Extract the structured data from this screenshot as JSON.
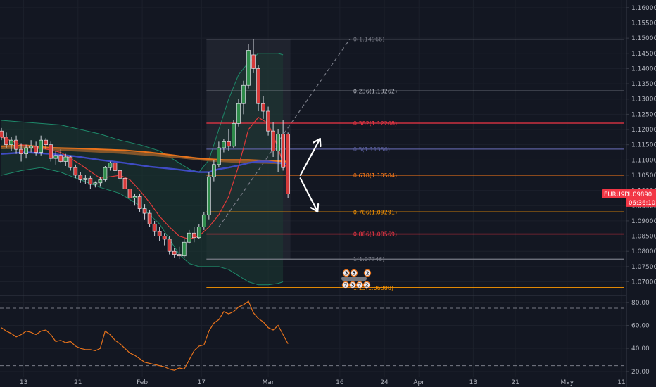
{
  "chart_data": {
    "type": "candlestick",
    "symbol": "EURUSD",
    "last_price": "1.09890",
    "countdown": "06:36:10",
    "price_axis": {
      "ylim": [
        1.0655,
        1.1625
      ],
      "ticks": [
        "1.16000",
        "1.15500",
        "1.15000",
        "1.14500",
        "1.14000",
        "1.13500",
        "1.13000",
        "1.12500",
        "1.12000",
        "1.11500",
        "1.11000",
        "1.10500",
        "1.10000",
        "1.09500",
        "1.09000",
        "1.08500",
        "1.08000",
        "1.07500",
        "1.07000"
      ]
    },
    "rsi_axis": {
      "ylim": [
        15,
        86
      ],
      "ticks": [
        "80.00",
        "60.00",
        "40.00",
        "20.00"
      ],
      "levels": [
        75,
        25
      ]
    },
    "x_axis": {
      "labels": [
        {
          "text": "13",
          "t": 4.5
        },
        {
          "text": "21",
          "t": 15.5
        },
        {
          "text": "Feb",
          "t": 28.5
        },
        {
          "text": "17",
          "t": 40.5
        },
        {
          "text": "Mar",
          "t": 54
        },
        {
          "text": "16",
          "t": 68.5
        },
        {
          "text": "24",
          "t": 77.5
        },
        {
          "text": "Apr",
          "t": 84.5
        },
        {
          "text": "13",
          "t": 95.5
        },
        {
          "text": "21",
          "t": 104
        },
        {
          "text": "May",
          "t": 114.5
        },
        {
          "text": "11",
          "t": 125.5
        }
      ]
    },
    "candles": [
      {
        "o": 1.1195,
        "h": 1.1205,
        "l": 1.1165,
        "c": 1.1175
      },
      {
        "o": 1.1175,
        "h": 1.119,
        "l": 1.114,
        "c": 1.115
      },
      {
        "o": 1.115,
        "h": 1.1175,
        "l": 1.113,
        "c": 1.1165
      },
      {
        "o": 1.1165,
        "h": 1.118,
        "l": 1.112,
        "c": 1.1135
      },
      {
        "o": 1.1135,
        "h": 1.1155,
        "l": 1.1095,
        "c": 1.112
      },
      {
        "o": 1.112,
        "h": 1.115,
        "l": 1.1105,
        "c": 1.114
      },
      {
        "o": 1.114,
        "h": 1.1165,
        "l": 1.1125,
        "c": 1.1145
      },
      {
        "o": 1.1145,
        "h": 1.116,
        "l": 1.1115,
        "c": 1.1125
      },
      {
        "o": 1.1125,
        "h": 1.118,
        "l": 1.1115,
        "c": 1.1165
      },
      {
        "o": 1.1165,
        "h": 1.1172,
        "l": 1.1135,
        "c": 1.115
      },
      {
        "o": 1.115,
        "h": 1.116,
        "l": 1.1095,
        "c": 1.1105
      },
      {
        "o": 1.1105,
        "h": 1.113,
        "l": 1.1085,
        "c": 1.1115
      },
      {
        "o": 1.1115,
        "h": 1.1135,
        "l": 1.109,
        "c": 1.1095
      },
      {
        "o": 1.1095,
        "h": 1.112,
        "l": 1.108,
        "c": 1.111
      },
      {
        "o": 1.111,
        "h": 1.1115,
        "l": 1.1065,
        "c": 1.1075
      },
      {
        "o": 1.1075,
        "h": 1.1085,
        "l": 1.104,
        "c": 1.105
      },
      {
        "o": 1.105,
        "h": 1.106,
        "l": 1.1025,
        "c": 1.1035
      },
      {
        "o": 1.1035,
        "h": 1.105,
        "l": 1.102,
        "c": 1.104
      },
      {
        "o": 1.104,
        "h": 1.1048,
        "l": 1.1005,
        "c": 1.102
      },
      {
        "o": 1.102,
        "h": 1.103,
        "l": 1.101,
        "c": 1.1025
      },
      {
        "o": 1.1025,
        "h": 1.1045,
        "l": 1.1012,
        "c": 1.1035
      },
      {
        "o": 1.1035,
        "h": 1.108,
        "l": 1.103,
        "c": 1.1075
      },
      {
        "o": 1.1075,
        "h": 1.1095,
        "l": 1.1065,
        "c": 1.109
      },
      {
        "o": 1.109,
        "h": 1.1095,
        "l": 1.1055,
        "c": 1.1065
      },
      {
        "o": 1.1065,
        "h": 1.107,
        "l": 1.1025,
        "c": 1.104
      },
      {
        "o": 1.104,
        "h": 1.1045,
        "l": 1.0995,
        "c": 1.1005
      },
      {
        "o": 1.1005,
        "h": 1.101,
        "l": 1.0955,
        "c": 1.0975
      },
      {
        "o": 1.0975,
        "h": 1.099,
        "l": 1.095,
        "c": 1.098
      },
      {
        "o": 1.098,
        "h": 1.099,
        "l": 1.093,
        "c": 1.094
      },
      {
        "o": 1.094,
        "h": 1.0955,
        "l": 1.0905,
        "c": 1.0925
      },
      {
        "o": 1.0925,
        "h": 1.0935,
        "l": 1.088,
        "c": 1.089
      },
      {
        "o": 1.089,
        "h": 1.09,
        "l": 1.085,
        "c": 1.0865
      },
      {
        "o": 1.0865,
        "h": 1.088,
        "l": 1.0835,
        "c": 1.085
      },
      {
        "o": 1.085,
        "h": 1.086,
        "l": 1.082,
        "c": 1.084
      },
      {
        "o": 1.084,
        "h": 1.085,
        "l": 1.079,
        "c": 1.08
      },
      {
        "o": 1.08,
        "h": 1.081,
        "l": 1.078,
        "c": 1.079
      },
      {
        "o": 1.079,
        "h": 1.0815,
        "l": 1.0775,
        "c": 1.0785
      },
      {
        "o": 1.0785,
        "h": 1.084,
        "l": 1.078,
        "c": 1.083
      },
      {
        "o": 1.083,
        "h": 1.087,
        "l": 1.0825,
        "c": 1.086
      },
      {
        "o": 1.086,
        "h": 1.088,
        "l": 1.083,
        "c": 1.0845
      },
      {
        "o": 1.0845,
        "h": 1.089,
        "l": 1.084,
        "c": 1.088
      },
      {
        "o": 1.088,
        "h": 1.093,
        "l": 1.087,
        "c": 1.092
      },
      {
        "o": 1.092,
        "h": 1.106,
        "l": 1.0905,
        "c": 1.1045
      },
      {
        "o": 1.1045,
        "h": 1.11,
        "l": 1.103,
        "c": 1.1085
      },
      {
        "o": 1.1085,
        "h": 1.116,
        "l": 1.1075,
        "c": 1.114
      },
      {
        "o": 1.114,
        "h": 1.117,
        "l": 1.1125,
        "c": 1.116
      },
      {
        "o": 1.116,
        "h": 1.12,
        "l": 1.113,
        "c": 1.1145
      },
      {
        "o": 1.1145,
        "h": 1.123,
        "l": 1.114,
        "c": 1.122
      },
      {
        "o": 1.122,
        "h": 1.13,
        "l": 1.121,
        "c": 1.1285
      },
      {
        "o": 1.1285,
        "h": 1.136,
        "l": 1.125,
        "c": 1.1345
      },
      {
        "o": 1.1345,
        "h": 1.148,
        "l": 1.1335,
        "c": 1.146
      },
      {
        "o": 1.1445,
        "h": 1.1497,
        "l": 1.1385,
        "c": 1.14
      },
      {
        "o": 1.14,
        "h": 1.141,
        "l": 1.126,
        "c": 1.1285
      },
      {
        "o": 1.1285,
        "h": 1.131,
        "l": 1.1235,
        "c": 1.126
      },
      {
        "o": 1.126,
        "h": 1.1275,
        "l": 1.118,
        "c": 1.1195
      },
      {
        "o": 1.1195,
        "h": 1.1225,
        "l": 1.111,
        "c": 1.113
      },
      {
        "o": 1.113,
        "h": 1.12,
        "l": 1.106,
        "c": 1.1185
      },
      {
        "o": 1.1185,
        "h": 1.123,
        "l": 1.1065,
        "c": 1.1075
      },
      {
        "o": 1.1185,
        "h": 1.119,
        "l": 1.0975,
        "c": 1.0989
      }
    ],
    "bollinger_upper": [
      [
        0,
        1.123
      ],
      [
        4,
        1.1225
      ],
      [
        8,
        1.122
      ],
      [
        12,
        1.1215
      ],
      [
        16,
        1.12
      ],
      [
        20,
        1.1185
      ],
      [
        24,
        1.1165
      ],
      [
        28,
        1.115
      ],
      [
        32,
        1.113
      ],
      [
        36,
        1.109
      ],
      [
        38,
        1.107
      ],
      [
        40,
        1.106
      ],
      [
        42,
        1.11
      ],
      [
        44,
        1.12
      ],
      [
        46,
        1.13
      ],
      [
        48,
        1.138
      ],
      [
        50,
        1.142
      ],
      [
        52,
        1.145
      ],
      [
        54,
        1.145
      ],
      [
        56,
        1.145
      ],
      [
        57,
        1.1445
      ]
    ],
    "bollinger_lower": [
      [
        0,
        1.105
      ],
      [
        4,
        1.1065
      ],
      [
        8,
        1.1075
      ],
      [
        12,
        1.106
      ],
      [
        16,
        1.1035
      ],
      [
        20,
        1.101
      ],
      [
        24,
        1.099
      ],
      [
        28,
        1.095
      ],
      [
        32,
        1.089
      ],
      [
        36,
        1.079
      ],
      [
        38,
        1.076
      ],
      [
        40,
        1.075
      ],
      [
        42,
        1.075
      ],
      [
        44,
        1.075
      ],
      [
        46,
        1.074
      ],
      [
        48,
        1.072
      ],
      [
        50,
        1.07
      ],
      [
        52,
        1.069
      ],
      [
        54,
        1.069
      ],
      [
        56,
        1.0695
      ],
      [
        57,
        1.07
      ]
    ],
    "sma_fast": [
      [
        0,
        1.1175
      ],
      [
        4,
        1.115
      ],
      [
        8,
        1.114
      ],
      [
        12,
        1.1125
      ],
      [
        16,
        1.1085
      ],
      [
        20,
        1.104
      ],
      [
        24,
        1.105
      ],
      [
        26,
        1.1035
      ],
      [
        28,
        1.1
      ],
      [
        30,
        1.096
      ],
      [
        32,
        1.0915
      ],
      [
        34,
        1.088
      ],
      [
        36,
        1.085
      ],
      [
        38,
        1.084
      ],
      [
        40,
        1.085
      ],
      [
        42,
        1.088
      ],
      [
        44,
        1.092
      ],
      [
        46,
        1.098
      ],
      [
        48,
        1.108
      ],
      [
        50,
        1.12
      ],
      [
        52,
        1.124
      ],
      [
        54,
        1.122
      ],
      [
        56,
        1.114
      ],
      [
        57,
        1.109
      ],
      [
        58,
        1.107
      ]
    ],
    "ma_blue": [
      [
        0,
        1.112
      ],
      [
        5,
        1.1125
      ],
      [
        10,
        1.112
      ],
      [
        15,
        1.1112
      ],
      [
        20,
        1.11
      ],
      [
        25,
        1.109
      ],
      [
        30,
        1.1078
      ],
      [
        35,
        1.107
      ],
      [
        40,
        1.106
      ],
      [
        42,
        1.106
      ],
      [
        44,
        1.107
      ],
      [
        46,
        1.1075
      ],
      [
        48,
        1.1082
      ],
      [
        50,
        1.109
      ],
      [
        52,
        1.1095
      ],
      [
        54,
        1.1095
      ],
      [
        56,
        1.109
      ],
      [
        58,
        1.1088
      ]
    ],
    "ma_orange": [
      [
        0,
        1.1145
      ],
      [
        5,
        1.1148
      ],
      [
        10,
        1.114
      ],
      [
        15,
        1.1138
      ],
      [
        20,
        1.1135
      ],
      [
        25,
        1.1132
      ],
      [
        30,
        1.1125
      ],
      [
        35,
        1.1115
      ],
      [
        40,
        1.1105
      ],
      [
        45,
        1.11
      ],
      [
        50,
        1.11
      ],
      [
        55,
        1.1097
      ],
      [
        58,
        1.1095
      ]
    ],
    "ma_brown": [
      [
        0,
        1.114
      ],
      [
        6,
        1.1142
      ],
      [
        12,
        1.1135
      ],
      [
        18,
        1.113
      ],
      [
        24,
        1.1125
      ],
      [
        30,
        1.1118
      ],
      [
        36,
        1.111
      ],
      [
        42,
        1.11
      ],
      [
        48,
        1.1095
      ],
      [
        54,
        1.1092
      ],
      [
        58,
        1.109
      ]
    ],
    "fib_levels": [
      {
        "ratio": "0",
        "price": 1.14966,
        "text": "0(1.14966)",
        "color": "#787b86"
      },
      {
        "ratio": "0.236",
        "price": 1.13262,
        "text": "0.236(1.13262)",
        "color": "#b2b5be"
      },
      {
        "ratio": "0.382",
        "price": 1.12208,
        "text": "0.382(1.12208)",
        "color": "#f23645"
      },
      {
        "ratio": "0.5",
        "price": 1.11356,
        "text": "0.5(1.11356)",
        "color": "#5b5f9e"
      },
      {
        "ratio": "0.618",
        "price": 1.10504,
        "text": "0.618(1.10504)",
        "color": "#ff7b18"
      },
      {
        "ratio": "0.786",
        "price": 1.09291,
        "text": "0.786(1.09291)",
        "color": "#ff9800"
      },
      {
        "ratio": "0.886",
        "price": 1.08569,
        "text": "0.886(1.08569)",
        "color": "#f23645"
      },
      {
        "ratio": "1",
        "price": 1.07746,
        "text": "1(1.07746)",
        "color": "#787b86"
      },
      {
        "ratio": "1.13",
        "price": 1.06808,
        "text": "1.13(1.06808)",
        "color": "#ff9800"
      }
    ],
    "fib_range": {
      "t_start": 41.5,
      "t_end": 70.5
    },
    "fib_trend": {
      "t1": 44,
      "p1": 1.088,
      "t2": 70.5,
      "p2": 1.14966
    },
    "fib_zone": {
      "t_start": 41.5,
      "t_end": 58.5
    },
    "arrows": [
      {
        "from": [
          60.5,
          1.105
        ],
        "to": [
          64.5,
          1.117
        ]
      },
      {
        "from": [
          60.5,
          1.104
        ],
        "to": [
          64,
          1.093
        ]
      }
    ],
    "events": {
      "top_row": [
        "3",
        "3",
        "2"
      ],
      "bottom_row": [
        "7",
        "3",
        "7",
        "2"
      ]
    },
    "rsi": [
      [
        0,
        58
      ],
      [
        1,
        55
      ],
      [
        2,
        53
      ],
      [
        3,
        50
      ],
      [
        4,
        52
      ],
      [
        5,
        55
      ],
      [
        6,
        54
      ],
      [
        7,
        52
      ],
      [
        8,
        55
      ],
      [
        9,
        56
      ],
      [
        10,
        52
      ],
      [
        11,
        46
      ],
      [
        12,
        47
      ],
      [
        13,
        45
      ],
      [
        14,
        46
      ],
      [
        15,
        42
      ],
      [
        16,
        40
      ],
      [
        17,
        39
      ],
      [
        18,
        39
      ],
      [
        19,
        38
      ],
      [
        20,
        40
      ],
      [
        21,
        55
      ],
      [
        22,
        52
      ],
      [
        23,
        47
      ],
      [
        24,
        44
      ],
      [
        25,
        40
      ],
      [
        26,
        36
      ],
      [
        27,
        34
      ],
      [
        28,
        31
      ],
      [
        29,
        28
      ],
      [
        30,
        27
      ],
      [
        31,
        26
      ],
      [
        32,
        25
      ],
      [
        33,
        24
      ],
      [
        34,
        22
      ],
      [
        35,
        21
      ],
      [
        36,
        23
      ],
      [
        37,
        22
      ],
      [
        38,
        30
      ],
      [
        39,
        38
      ],
      [
        40,
        42
      ],
      [
        41,
        43
      ],
      [
        42,
        55
      ],
      [
        43,
        62
      ],
      [
        44,
        65
      ],
      [
        45,
        72
      ],
      [
        46,
        70
      ],
      [
        47,
        72
      ],
      [
        48,
        76
      ],
      [
        49,
        78
      ],
      [
        50,
        81
      ],
      [
        51,
        71
      ],
      [
        52,
        66
      ],
      [
        53,
        63
      ],
      [
        54,
        58
      ],
      [
        55,
        56
      ],
      [
        56,
        60
      ],
      [
        57,
        52
      ],
      [
        58,
        44
      ]
    ]
  }
}
